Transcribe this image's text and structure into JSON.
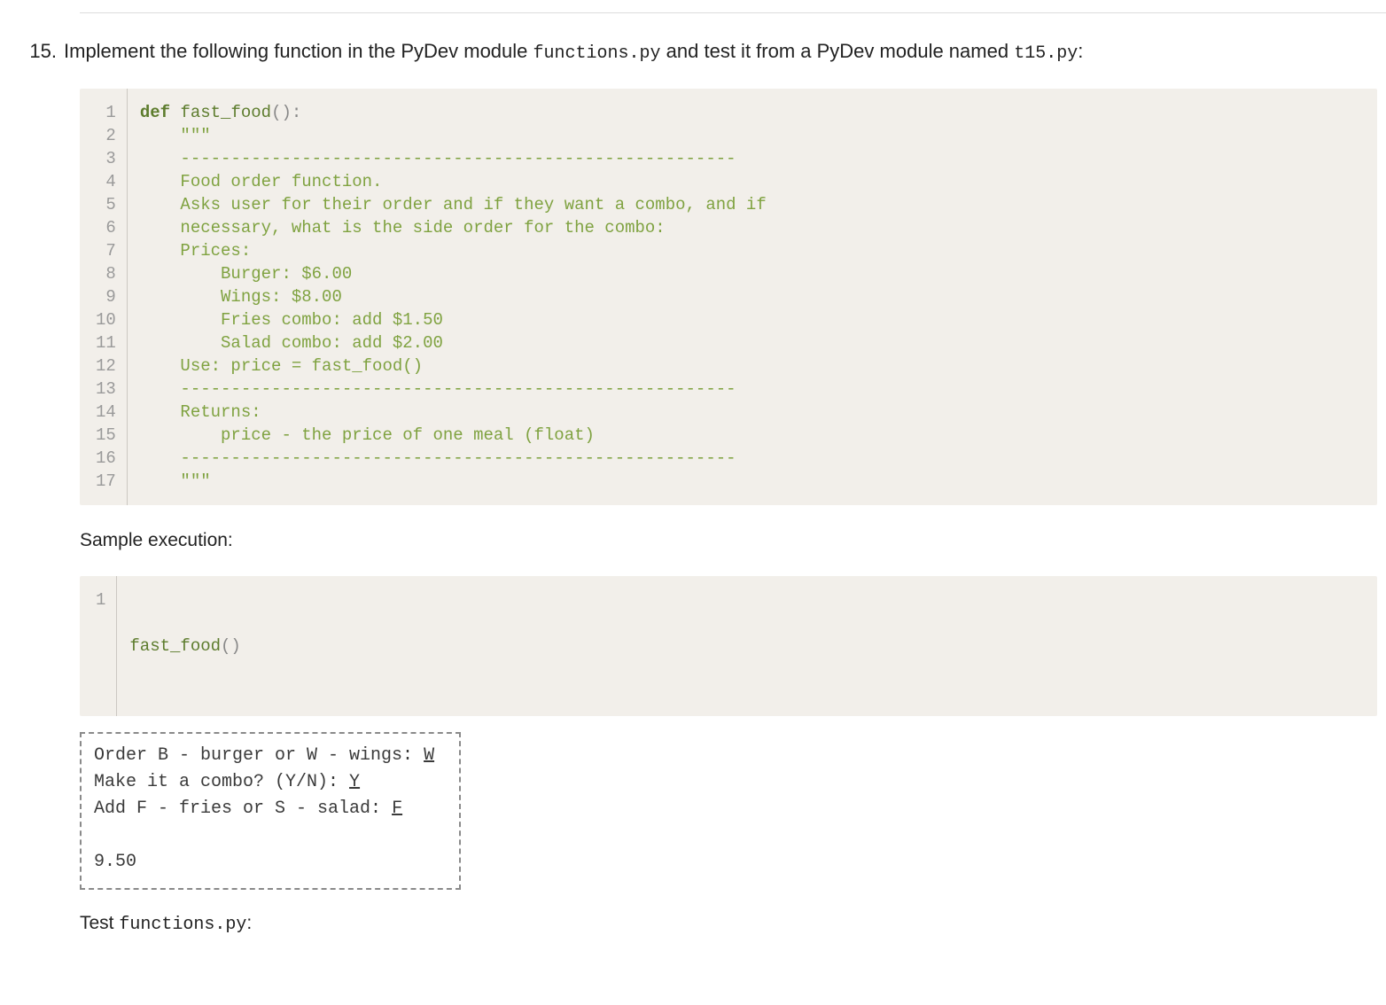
{
  "question": {
    "number": "15.",
    "prefix": "Implement the following function in the PyDev module ",
    "file1": "functions.py",
    "mid": " and test it from a PyDev module named ",
    "file2": "t15.py",
    "suffix": ":"
  },
  "code1": {
    "lines": [
      {
        "n": "1",
        "kw": "def",
        "sp": " ",
        "fn": "fast_food",
        "pn": "():"
      },
      {
        "n": "2",
        "doc": "    \"\"\""
      },
      {
        "n": "3",
        "doc": "    -------------------------------------------------------"
      },
      {
        "n": "4",
        "doc": "    Food order function."
      },
      {
        "n": "5",
        "doc": "    Asks user for their order and if they want a combo, and if"
      },
      {
        "n": "6",
        "doc": "    necessary, what is the side order for the combo:"
      },
      {
        "n": "7",
        "doc": "    Prices:"
      },
      {
        "n": "8",
        "doc": "        Burger: $6.00"
      },
      {
        "n": "9",
        "doc": "        Wings: $8.00"
      },
      {
        "n": "10",
        "doc": "        Fries combo: add $1.50"
      },
      {
        "n": "11",
        "doc": "        Salad combo: add $2.00"
      },
      {
        "n": "12",
        "doc": "    Use: price = fast_food()"
      },
      {
        "n": "13",
        "doc": "    -------------------------------------------------------"
      },
      {
        "n": "14",
        "doc": "    Returns:"
      },
      {
        "n": "15",
        "doc": "        price - the price of one meal (float)"
      },
      {
        "n": "16",
        "doc": "    -------------------------------------------------------"
      },
      {
        "n": "17",
        "doc": "    \"\"\""
      }
    ]
  },
  "sample_label": "Sample execution:",
  "code2": {
    "n": "1",
    "fn": "fast_food",
    "pn": "()"
  },
  "output": {
    "l1_a": "Order B - burger or W - wings: ",
    "l1_u": "W",
    "l2_a": "Make it a combo? (Y/N): ",
    "l2_u": "Y",
    "l3_a": "Add F - fries or S - salad: ",
    "l3_u": "F",
    "l5": "9.50"
  },
  "test_label_a": "Test ",
  "test_label_file": "functions.py",
  "test_label_b": ":"
}
